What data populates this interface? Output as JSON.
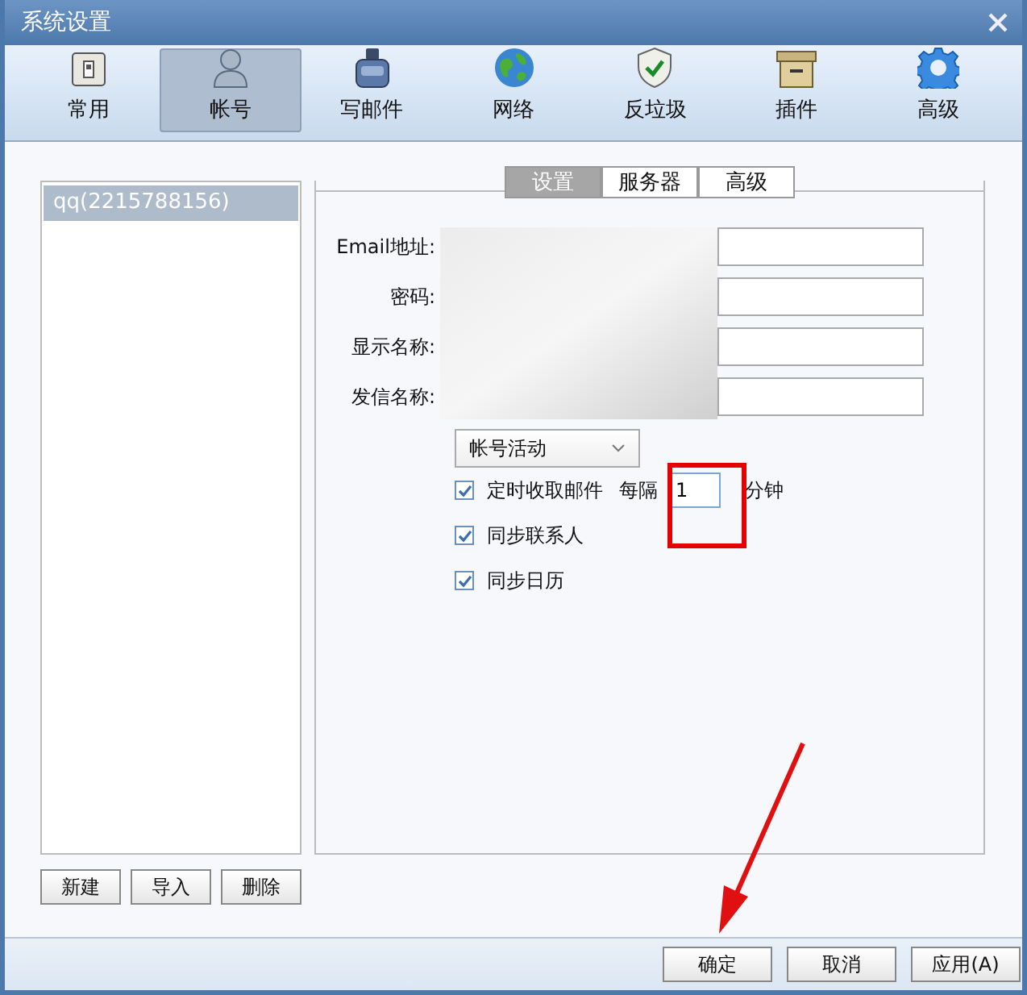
{
  "window": {
    "title": "系统设置"
  },
  "toolbar": [
    {
      "label": "常用",
      "selected": false
    },
    {
      "label": "帐号",
      "selected": true
    },
    {
      "label": "写邮件",
      "selected": false
    },
    {
      "label": "网络",
      "selected": false
    },
    {
      "label": "反垃圾",
      "selected": false
    },
    {
      "label": "插件",
      "selected": false
    },
    {
      "label": "高级",
      "selected": false
    }
  ],
  "accounts": [
    {
      "label": "qq(2215788156)",
      "selected": true
    }
  ],
  "tabs": [
    {
      "label": "设置",
      "selected": true
    },
    {
      "label": "服务器",
      "selected": false
    },
    {
      "label": "高级",
      "selected": false
    }
  ],
  "fields": [
    {
      "label": "Email地址:"
    },
    {
      "label": "密码:"
    },
    {
      "label": "显示名称:"
    },
    {
      "label": "发信名称:"
    }
  ],
  "dropdown": {
    "value": "帐号活动"
  },
  "options": [
    {
      "label": "定时收取邮件",
      "checked": true,
      "interval": {
        "prefix": "每隔",
        "value": "1",
        "suffix": "分钟"
      }
    },
    {
      "label": "同步联系人",
      "checked": true
    },
    {
      "label": "同步日历",
      "checked": true
    }
  ],
  "account_buttons": [
    "新建",
    "导入",
    "删除"
  ],
  "footer_buttons": [
    "确定",
    "取消",
    "应用(A)"
  ]
}
